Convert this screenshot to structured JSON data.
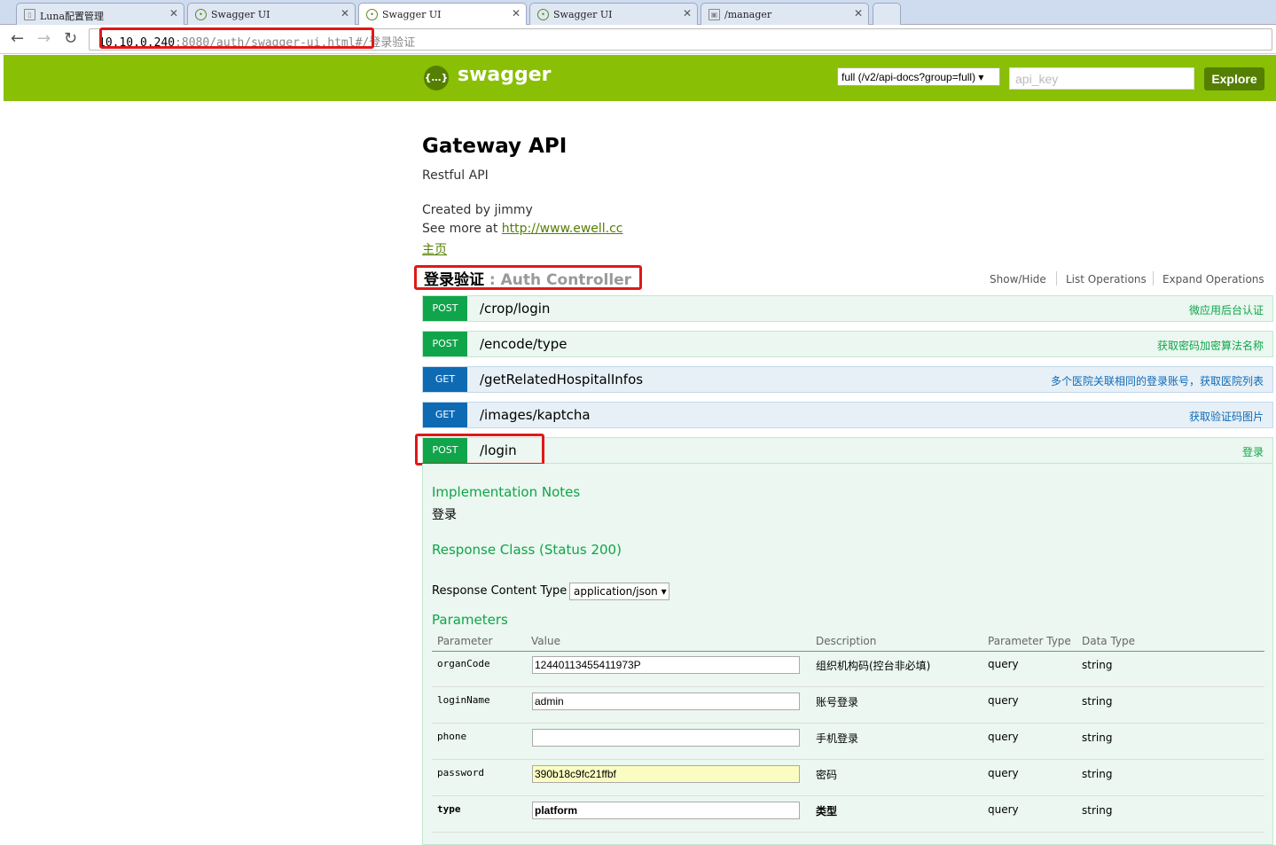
{
  "browser": {
    "tabs": [
      {
        "label": "Luna配置管理",
        "icon": "document-icon"
      },
      {
        "label": "Swagger UI",
        "icon": "swagger-icon"
      },
      {
        "label": "Swagger UI",
        "icon": "swagger-icon"
      },
      {
        "label": "Swagger UI",
        "icon": "swagger-icon"
      },
      {
        "label": "/manager",
        "icon": "image-icon"
      }
    ],
    "close_glyph": "✕",
    "url_host": "10.10.0.240",
    "url_rest": ":8080/auth/swagger-ui.html",
    "url_hash": "#/登录验证"
  },
  "header": {
    "logo_text": "swagger",
    "logo_glyph": "{…}",
    "spec_select": "full (/v2/api-docs?group=full)",
    "api_key_placeholder": "api_key",
    "explore_label": "Explore"
  },
  "info": {
    "title": "Gateway API",
    "subtitle": "Restful API",
    "created_by": "Created by jimmy",
    "see_more_prefix": "See more at ",
    "see_more_link": "http://www.ewell.cc",
    "home_link": "主页"
  },
  "resource": {
    "name": "登录验证",
    "separator": " : ",
    "controller": "Auth Controller",
    "actions": [
      "Show/Hide",
      "List Operations",
      "Expand Operations"
    ]
  },
  "operations": [
    {
      "method": "POST",
      "path": "/crop/login",
      "summary": "微应用后台认证"
    },
    {
      "method": "POST",
      "path": "/encode/type",
      "summary": "获取密码加密算法名称"
    },
    {
      "method": "GET",
      "path": "/getRelatedHospitalInfos",
      "summary": "多个医院关联相同的登录账号，获取医院列表"
    },
    {
      "method": "GET",
      "path": "/images/kaptcha",
      "summary": "获取验证码图片"
    },
    {
      "method": "POST",
      "path": "/login",
      "summary": "登录"
    }
  ],
  "expanded": {
    "impl_notes_title": "Implementation Notes",
    "impl_notes": "登录",
    "response_class_title": "Response Class (Status 200)",
    "response_ct_label": "Response Content Type",
    "response_ct_value": "application/json",
    "parameters_title": "Parameters",
    "columns": [
      "Parameter",
      "Value",
      "Description",
      "Parameter Type",
      "Data Type"
    ],
    "params": [
      {
        "name": "organCode",
        "value": "12440113455411973P",
        "desc": "组织机构码(控台非必填)",
        "ptype": "query",
        "dtype": "string"
      },
      {
        "name": "loginName",
        "value": "admin",
        "desc": "账号登录",
        "ptype": "query",
        "dtype": "string"
      },
      {
        "name": "phone",
        "value": "",
        "desc": "手机登录",
        "ptype": "query",
        "dtype": "string"
      },
      {
        "name": "password",
        "value": "390b18c9fc21ffbf",
        "desc": "密码",
        "ptype": "query",
        "dtype": "string"
      },
      {
        "name": "type",
        "value": "platform",
        "desc": "类型",
        "ptype": "query",
        "dtype": "string"
      }
    ]
  }
}
